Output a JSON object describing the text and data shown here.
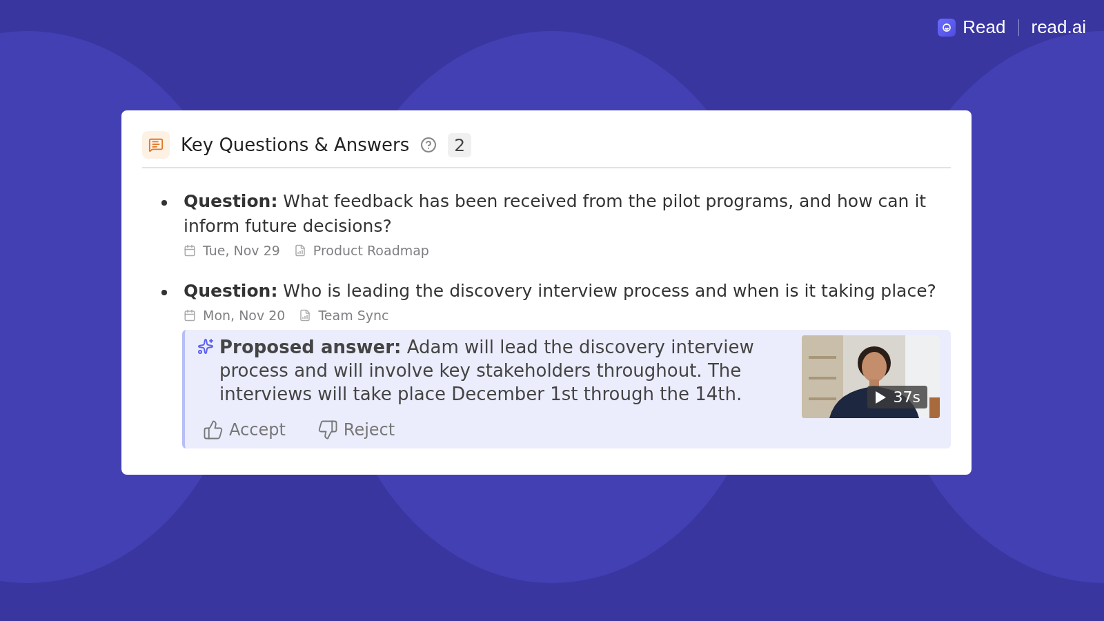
{
  "brand": {
    "name": "Read",
    "domain": "read.ai"
  },
  "card": {
    "title": "Key Questions & Answers",
    "count": "2"
  },
  "questions": [
    {
      "text": "**Question:** What feedback has been received from the pilot programs, and how can it inform future decisions?",
      "date": "Tue, Nov 29",
      "meeting": "Product Roadmap"
    },
    {
      "text": "**Question:** Who is leading the discovery interview process and when is it taking place?",
      "date": "Mon, Nov 20",
      "meeting": "Team Sync",
      "answer": {
        "text": "**Proposed answer:** Adam will lead the discovery interview process and will involve key stakeholders throughout. The interviews will take place December 1st through the 14th.",
        "duration": "37s",
        "actions": [
          {
            "kind": "accept",
            "label": "Accept"
          },
          {
            "kind": "reject",
            "label": "Reject"
          }
        ]
      }
    }
  ]
}
